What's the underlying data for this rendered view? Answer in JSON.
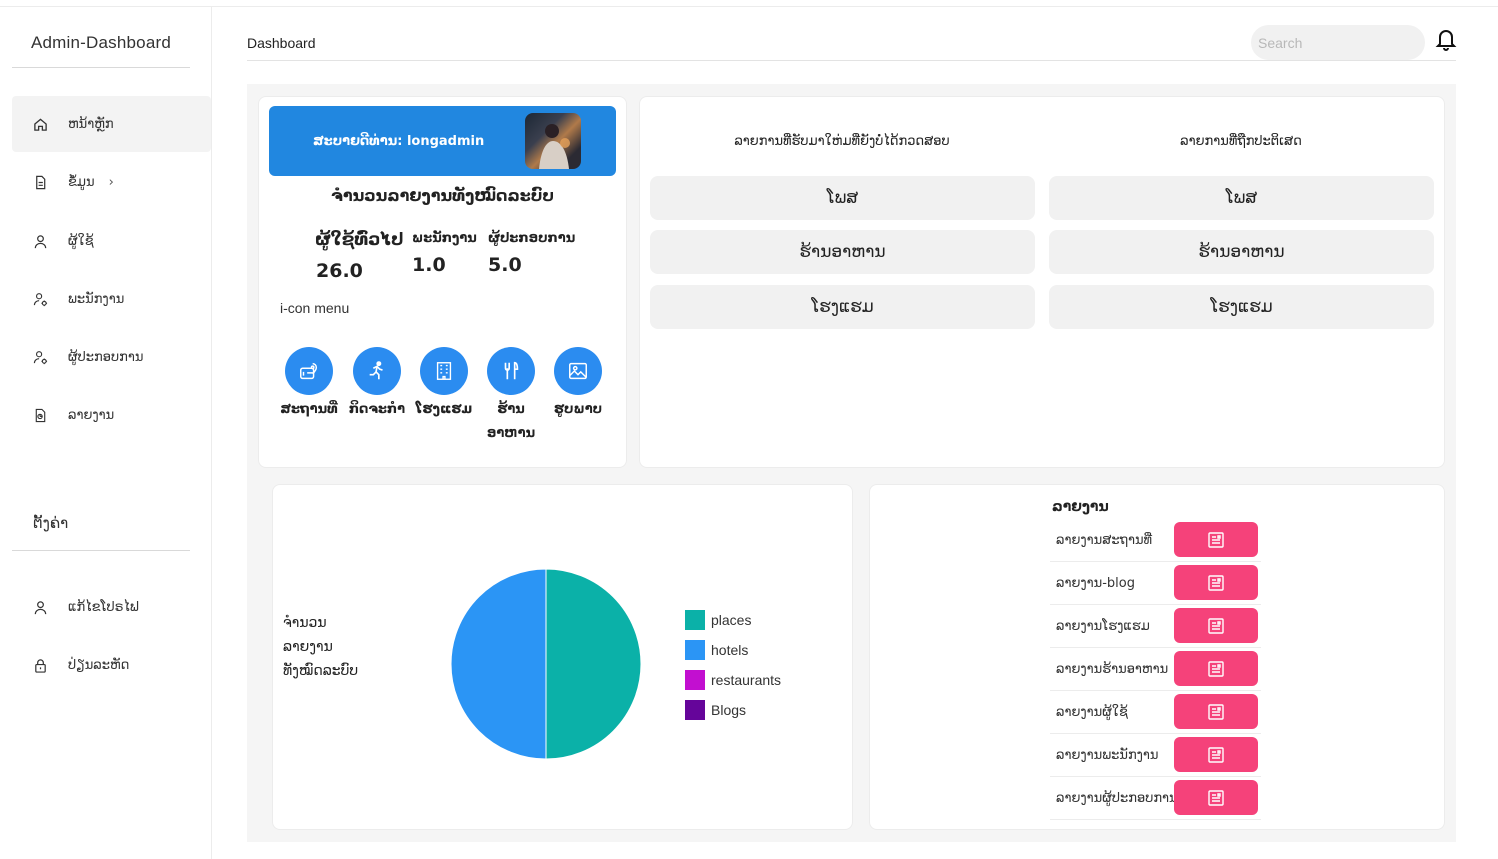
{
  "app": {
    "brand": "Admin-Dashboard"
  },
  "sidebar": {
    "items": [
      {
        "label": "ຫນ້າຫຼັກ",
        "icon": "home-icon",
        "active": true
      },
      {
        "label": "ຂໍ້ມູນ",
        "icon": "document-icon",
        "has_submenu": true
      },
      {
        "label": "ຜູ້ໃຊ້",
        "icon": "user-icon"
      },
      {
        "label": "ພະນັກງານ",
        "icon": "user-cog-icon"
      },
      {
        "label": "ຜູ້ປະກອບການ",
        "icon": "user-cog-icon"
      },
      {
        "label": "ລາຍງານ",
        "icon": "report-icon"
      }
    ],
    "settings_title": "ຕັ້ງຄ່າ",
    "settings_items": [
      {
        "label": "ແກ້ໄຂໂປຣໄຟ",
        "icon": "user-icon"
      },
      {
        "label": "ປ່ຽນລະຫັດ",
        "icon": "lock-icon"
      }
    ]
  },
  "header": {
    "title": "Dashboard",
    "search_placeholder": "Search",
    "bell_icon": "bell-icon"
  },
  "welcome": {
    "greeting": "ສະບາຍດີທ່ານ: longadmin"
  },
  "summary": {
    "heading": "ຈໍານວນລາຍງານທັງໝົດລະບົບ",
    "stats": [
      {
        "label": "ຜູ້ໃຊ້ທົ່ວໄປ",
        "value": "26.0"
      },
      {
        "label": "ພະນັກງານ",
        "value": "1.0"
      },
      {
        "label": "ຜູ້ປະກອບການ",
        "value": "5.0"
      }
    ],
    "icon_menu_label": "i-con menu",
    "categories": [
      {
        "label": "ສະຖານທີ່",
        "icon": "place-icon"
      },
      {
        "label": "ກິດຈະກໍາ",
        "icon": "running-icon"
      },
      {
        "label": "ໂຮງແຮມ",
        "icon": "hotel-icon"
      },
      {
        "label": "ຮ້ານອາຫານ",
        "icon": "restaurant-icon"
      },
      {
        "label": "ຮູບພາບ",
        "icon": "image-icon"
      }
    ]
  },
  "review": {
    "columns": [
      {
        "title": "ລາຍການທີ່ຮັບມາໃຫ່ມທີ່ຍັງບໍ່ໄດ້ກວດສອບ",
        "items": [
          "ໂພສ",
          "ຮ້ານອາຫານ",
          "ໂຮງແຮມ"
        ]
      },
      {
        "title": "ລາຍການທີ່ຖືກປະຕິເສດ",
        "items": [
          "ໂພສ",
          "ຮ້ານອາຫານ",
          "ໂຮງແຮມ"
        ]
      }
    ]
  },
  "pie": {
    "side_label": "ຈໍານວນລາຍງານທັງໝົດລະບົບ"
  },
  "chart_data": {
    "type": "pie",
    "categories": [
      "places",
      "hotels",
      "restaurants",
      "Blogs"
    ],
    "values": [
      50,
      50,
      0,
      0
    ],
    "colors": [
      "#0bb1a8",
      "#2b95f5",
      "#c20fd0",
      "#65059a"
    ],
    "legend_position": "right"
  },
  "reports": {
    "title": "ລາຍງານ",
    "items": [
      {
        "label": "ລາຍງານສະຖານທີ່"
      },
      {
        "label": "ລາຍງານ-blog"
      },
      {
        "label": "ລາຍງານໂຮງແຮມ"
      },
      {
        "label": "ລາຍງານຮ້ານອາຫານ"
      },
      {
        "label": "ລາຍງານຜູ້ໃຊ້"
      },
      {
        "label": "ລາຍງານພະນັກງານ"
      },
      {
        "label": "ລາຍງານຜູ້ປະກອບການ"
      }
    ],
    "button_icon": "report-document-icon",
    "button_color": "#f5427a"
  }
}
